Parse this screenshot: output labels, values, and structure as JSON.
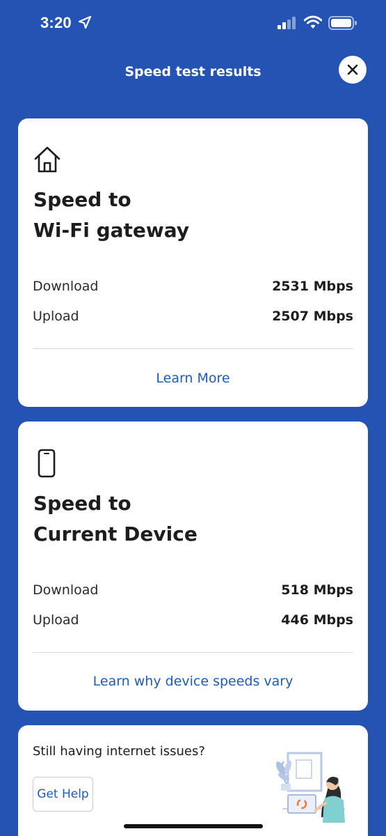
{
  "status_bar": {
    "time": "3:20",
    "icons": [
      "location-arrow-icon",
      "cellular-signal-icon",
      "wifi-icon",
      "battery-icon"
    ]
  },
  "header": {
    "title": "Speed test results",
    "close_icon": "close-icon"
  },
  "cards": {
    "gateway": {
      "icon": "home-icon",
      "title_line1": "Speed to",
      "title_line2": "Wi-Fi gateway",
      "download_label": "Download",
      "download_value": "2531 Mbps",
      "upload_label": "Upload",
      "upload_value": "2507 Mbps",
      "link": "Learn More"
    },
    "device": {
      "icon": "smartphone-icon",
      "title_line1": "Speed to",
      "title_line2": "Current Device",
      "download_label": "Download",
      "download_value": "518 Mbps",
      "upload_label": "Upload",
      "upload_value": "446 Mbps",
      "link": "Learn why device speeds vary"
    },
    "help": {
      "title": "Still having internet issues?",
      "button": "Get Help"
    }
  },
  "colors": {
    "background": "#2453b3",
    "card": "#ffffff",
    "link": "#1f5bb8",
    "text": "#1d1d1d"
  }
}
